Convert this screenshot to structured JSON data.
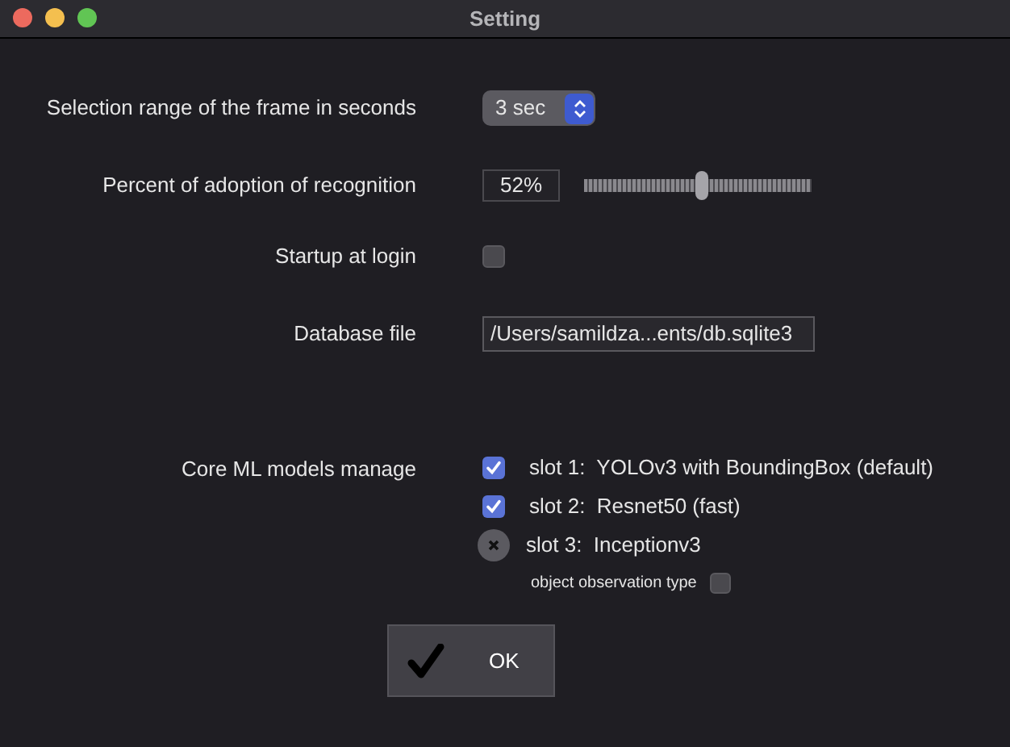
{
  "window": {
    "title": "Setting"
  },
  "frame_range": {
    "label": "Selection range of the frame in seconds",
    "value": "3 sec"
  },
  "adoption": {
    "label": "Percent of adoption of recognition",
    "value": "52%",
    "level": 0.52
  },
  "startup": {
    "label": "Startup at login",
    "checked": false
  },
  "database": {
    "label": "Database file",
    "value": "/Users/samildza...ents/db.sqlite3"
  },
  "models": {
    "label": "Core ML models manage",
    "slots": [
      {
        "kind": "checkbox",
        "checked": true,
        "label": "slot 1:  YOLOv3 with BoundingBox (default)"
      },
      {
        "kind": "checkbox",
        "checked": true,
        "label": "slot 2:  Resnet50 (fast)"
      },
      {
        "kind": "remove",
        "label": "slot 3:  Inceptionv3",
        "option": {
          "label": "object observation type",
          "checked": false
        }
      }
    ]
  },
  "ok_button": {
    "label": "OK"
  }
}
